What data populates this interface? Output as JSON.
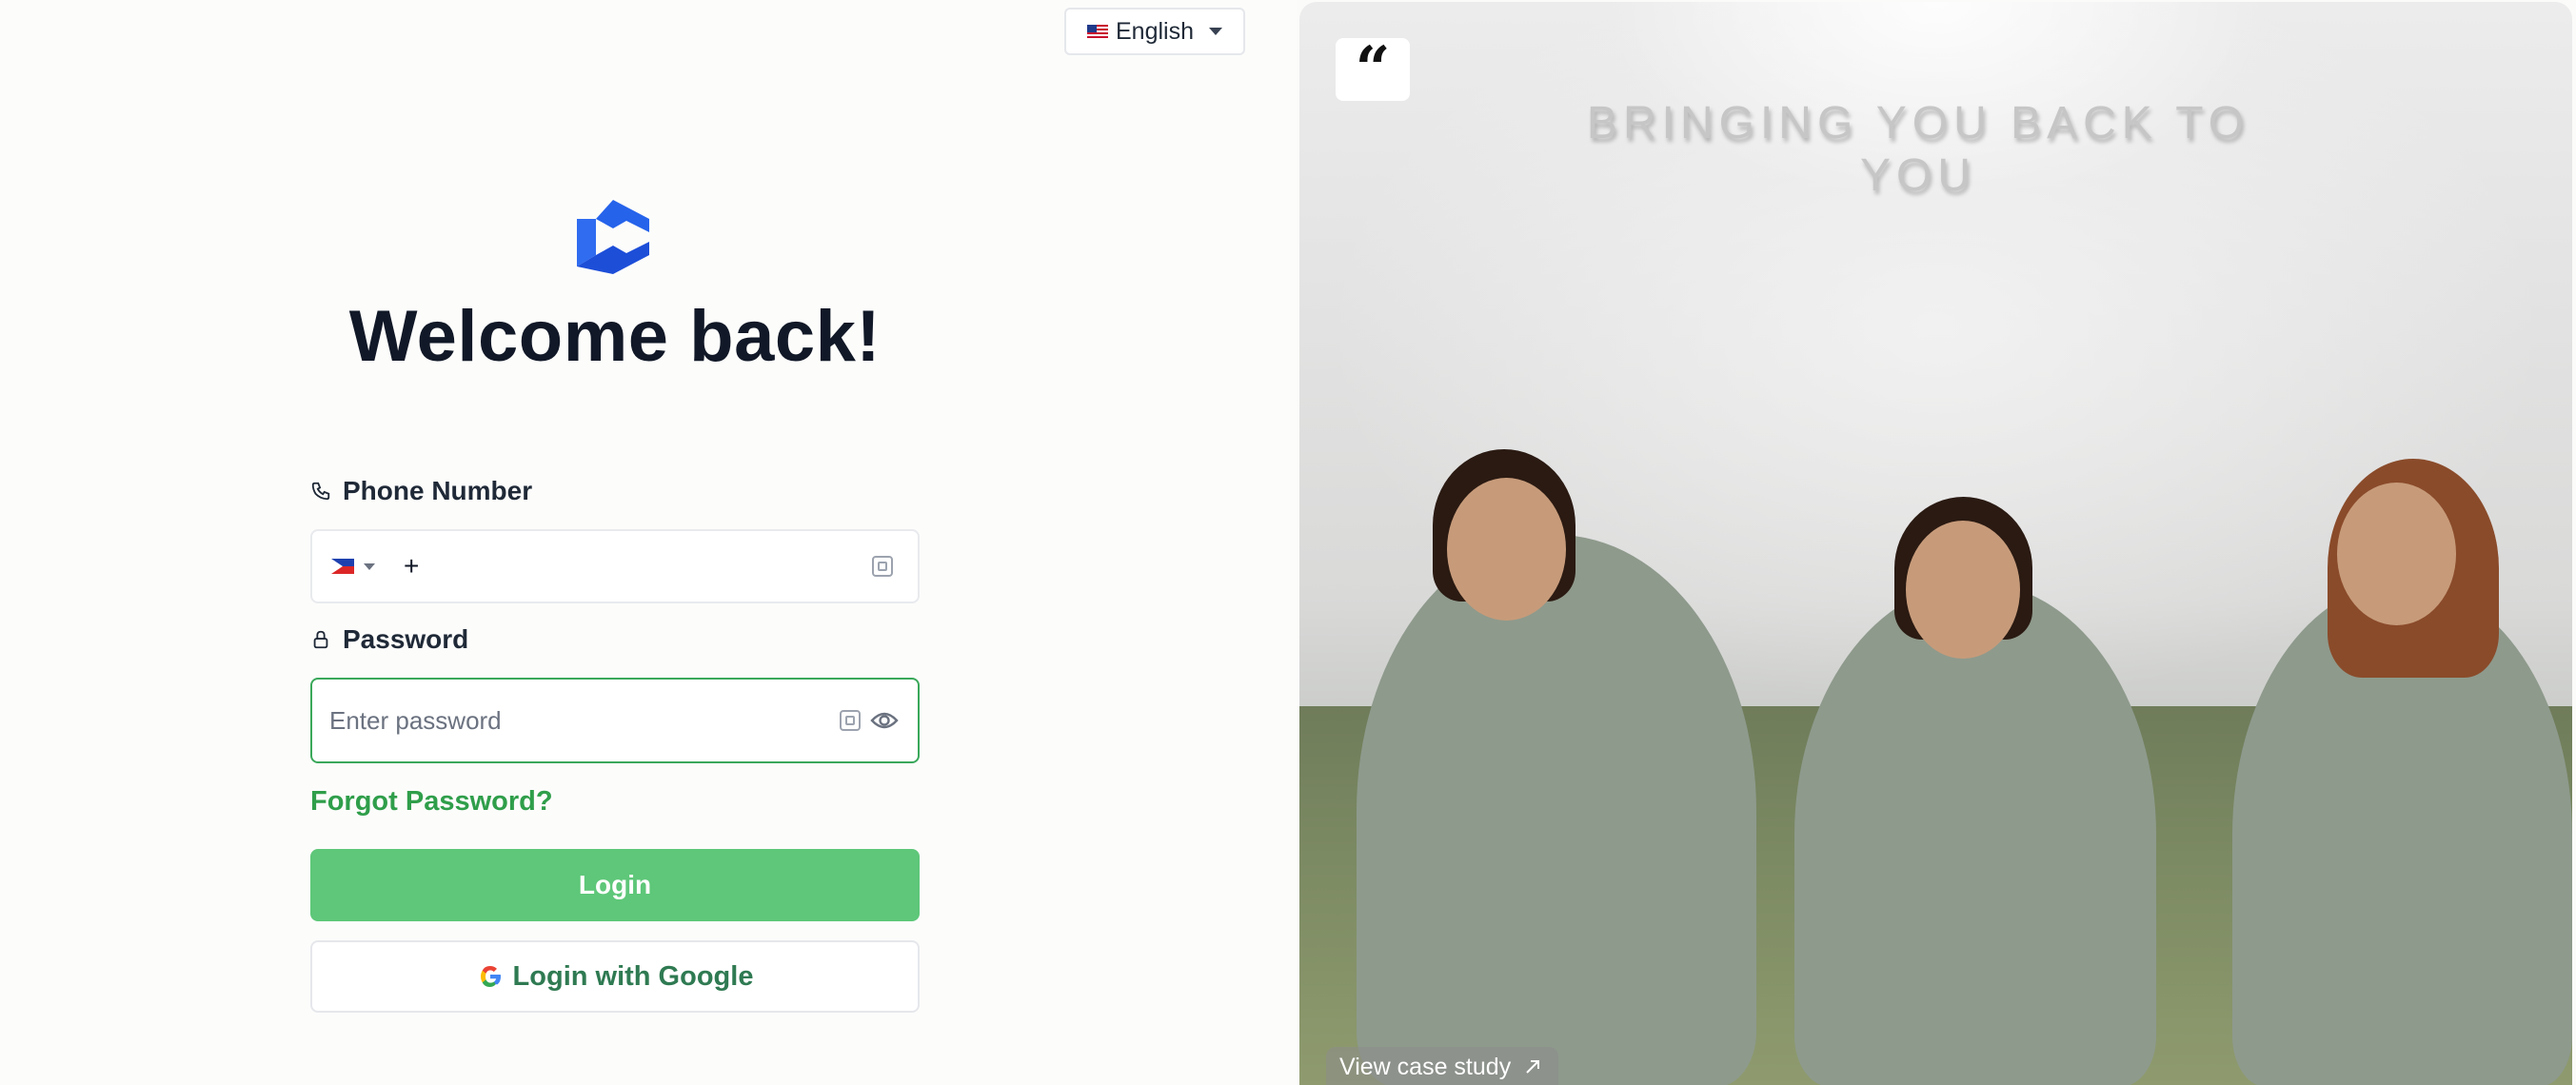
{
  "language_selector": {
    "label": "English",
    "flag": "us-flag-icon"
  },
  "header": {
    "title": "Welcome back!"
  },
  "phone": {
    "label": "Phone Number",
    "country_flag": "ph-flag-icon",
    "prefix": "+"
  },
  "password": {
    "label": "Password",
    "placeholder": "Enter password"
  },
  "links": {
    "forgot": "Forgot Password?"
  },
  "buttons": {
    "login": "Login",
    "google": "Login with Google"
  },
  "promo": {
    "slogan": "BRINGING YOU BACK TO YOU",
    "quote_mark": "“",
    "case_study": "View case study"
  },
  "colors": {
    "accent": "#5ec779",
    "link": "#2f9e4a",
    "logo": "#2563eb",
    "focus_border": "#3aa85a"
  }
}
